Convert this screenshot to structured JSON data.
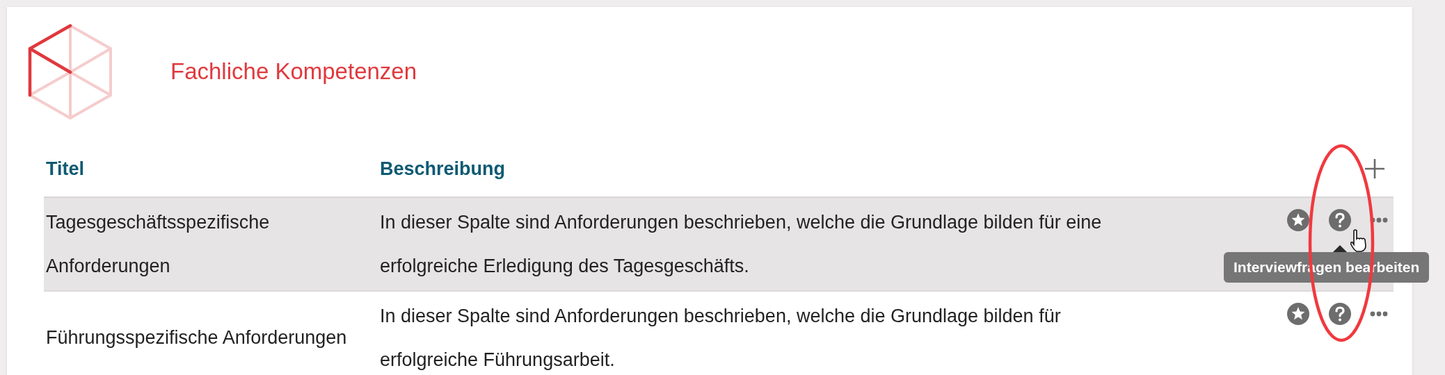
{
  "card": {
    "title": "Fachliche Kompetenzen"
  },
  "table": {
    "columns": [
      "Titel",
      "Beschreibung"
    ],
    "rows": [
      {
        "title": "Tagesgeschäftsspezifische Anforderungen",
        "description": "In dieser Spalte sind Anforderungen beschrieben, welche die Grundlage bilden für eine erfolgreiche Erledigung des Tagesgeschäfts.",
        "selected": true,
        "tooltip": "Interviewfragen bearbeiten"
      },
      {
        "title": "Führungsspezifische Anforderungen",
        "description": "In dieser Spalte sind Anforderungen beschrieben, welche die Grundlage bilden für erfolgreiche Führungsarbeit.",
        "selected": false
      }
    ]
  }
}
